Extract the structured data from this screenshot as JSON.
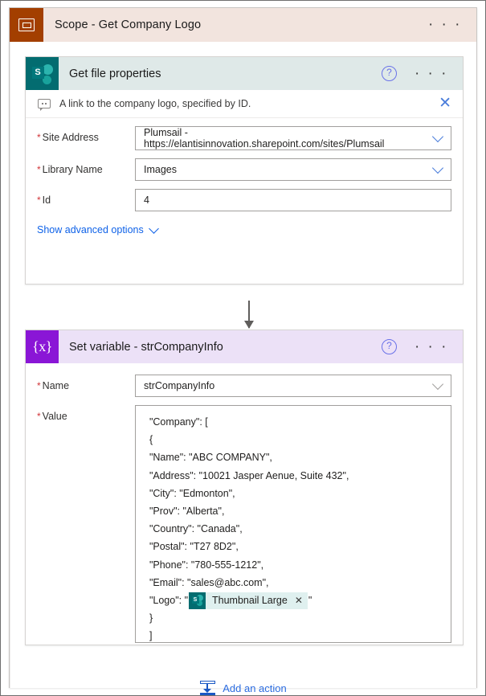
{
  "scope": {
    "title": "Scope - Get Company Logo",
    "icon": "scope-icon",
    "overflow": "· · ·"
  },
  "actions": {
    "get_file_properties": {
      "title": "Get file properties",
      "icon": "sharepoint-icon",
      "help": "?",
      "overflow": "· · ·",
      "comment": {
        "icon": "comment-icon",
        "text": "A link to the company logo, specified by ID.",
        "close": "✕"
      },
      "fields": [
        {
          "label": "Site Address",
          "required": true,
          "value": "Plumsail - https://elantisinnovation.sharepoint.com/sites/Plumsail",
          "control": "dropdown",
          "chevron_color": "blue"
        },
        {
          "label": "Library Name",
          "required": true,
          "value": "Images",
          "control": "dropdown",
          "chevron_color": "blue"
        },
        {
          "label": "Id",
          "required": true,
          "value": "4",
          "control": "text",
          "chevron_color": "none"
        }
      ],
      "advanced_options_label": "Show advanced options"
    },
    "set_variable": {
      "title": "Set variable - strCompanyInfo",
      "icon": "variable-icon",
      "icon_glyph": "{x}",
      "help": "?",
      "overflow": "· · ·",
      "fields": [
        {
          "label": "Name",
          "required": true,
          "value": "strCompanyInfo",
          "control": "dropdown",
          "chevron_color": "gray"
        }
      ],
      "value_field": {
        "label": "Value",
        "required": true,
        "lines": [
          {
            "text": "  \"Company\": ["
          },
          {
            "text": "  {"
          },
          {
            "text": "  \"Name\": \"ABC COMPANY\","
          },
          {
            "text": "  \"Address\": \"10021 Jasper Aenue, Suite 432\","
          },
          {
            "text": "  \"City\": \"Edmonton\","
          },
          {
            "text": "  \"Prov\": \"Alberta\","
          },
          {
            "text": "  \"Country\": \"Canada\","
          },
          {
            "text": "  \"Postal\": \"T27 8D2\","
          },
          {
            "text": "  \"Phone\": \"780-555-1212\","
          },
          {
            "text": "  \"Email\": \"sales@abc.com\","
          },
          {
            "text": "  \"Logo\": \"",
            "token": {
              "label": "Thumbnail Large",
              "icon": "sharepoint-icon",
              "remove": "✕"
            },
            "suffix": "\""
          },
          {
            "text": "  }"
          },
          {
            "text": "  ]"
          }
        ]
      }
    }
  },
  "footer": {
    "add_action_label": "Add an action",
    "add_action_icon": "insert-action-icon"
  },
  "colors": {
    "scope_accent": "#a33f00",
    "scope_header_bg": "#f2e4de",
    "sharepoint_accent": "#036c70",
    "sharepoint_header_bg": "#dfe9e8",
    "variable_accent": "#8a16d6",
    "variable_header_bg": "#ece1f7",
    "link_blue": "#0f62e8",
    "required_red": "#d13438"
  }
}
